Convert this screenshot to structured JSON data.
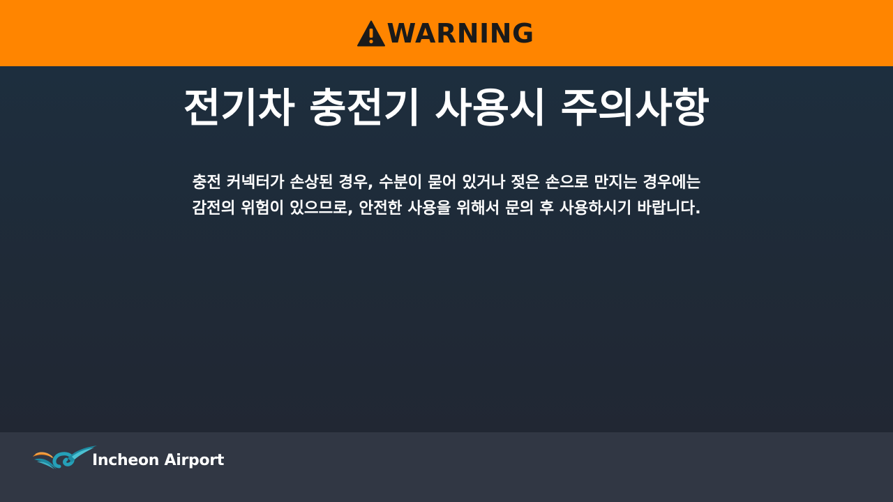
{
  "banner": {
    "warning_label": "WARNING",
    "icon": "warning-triangle-icon",
    "background_color": "#ff8500"
  },
  "main": {
    "title": "전기차 충전기 사용시 주의사항",
    "body_lines": [
      "충전 커넥터가 손상된 경우, 수분이 묻어 있거나 젖은 손으로 만지는 경우에는",
      "감전의 위험이 있으므로, 안전한 사용을 위해서 문의 후 사용하시기 바랍니다."
    ]
  },
  "footer": {
    "logo_text": "Incheon Airport",
    "logo_icon": "incheon-airport-logo-icon"
  }
}
